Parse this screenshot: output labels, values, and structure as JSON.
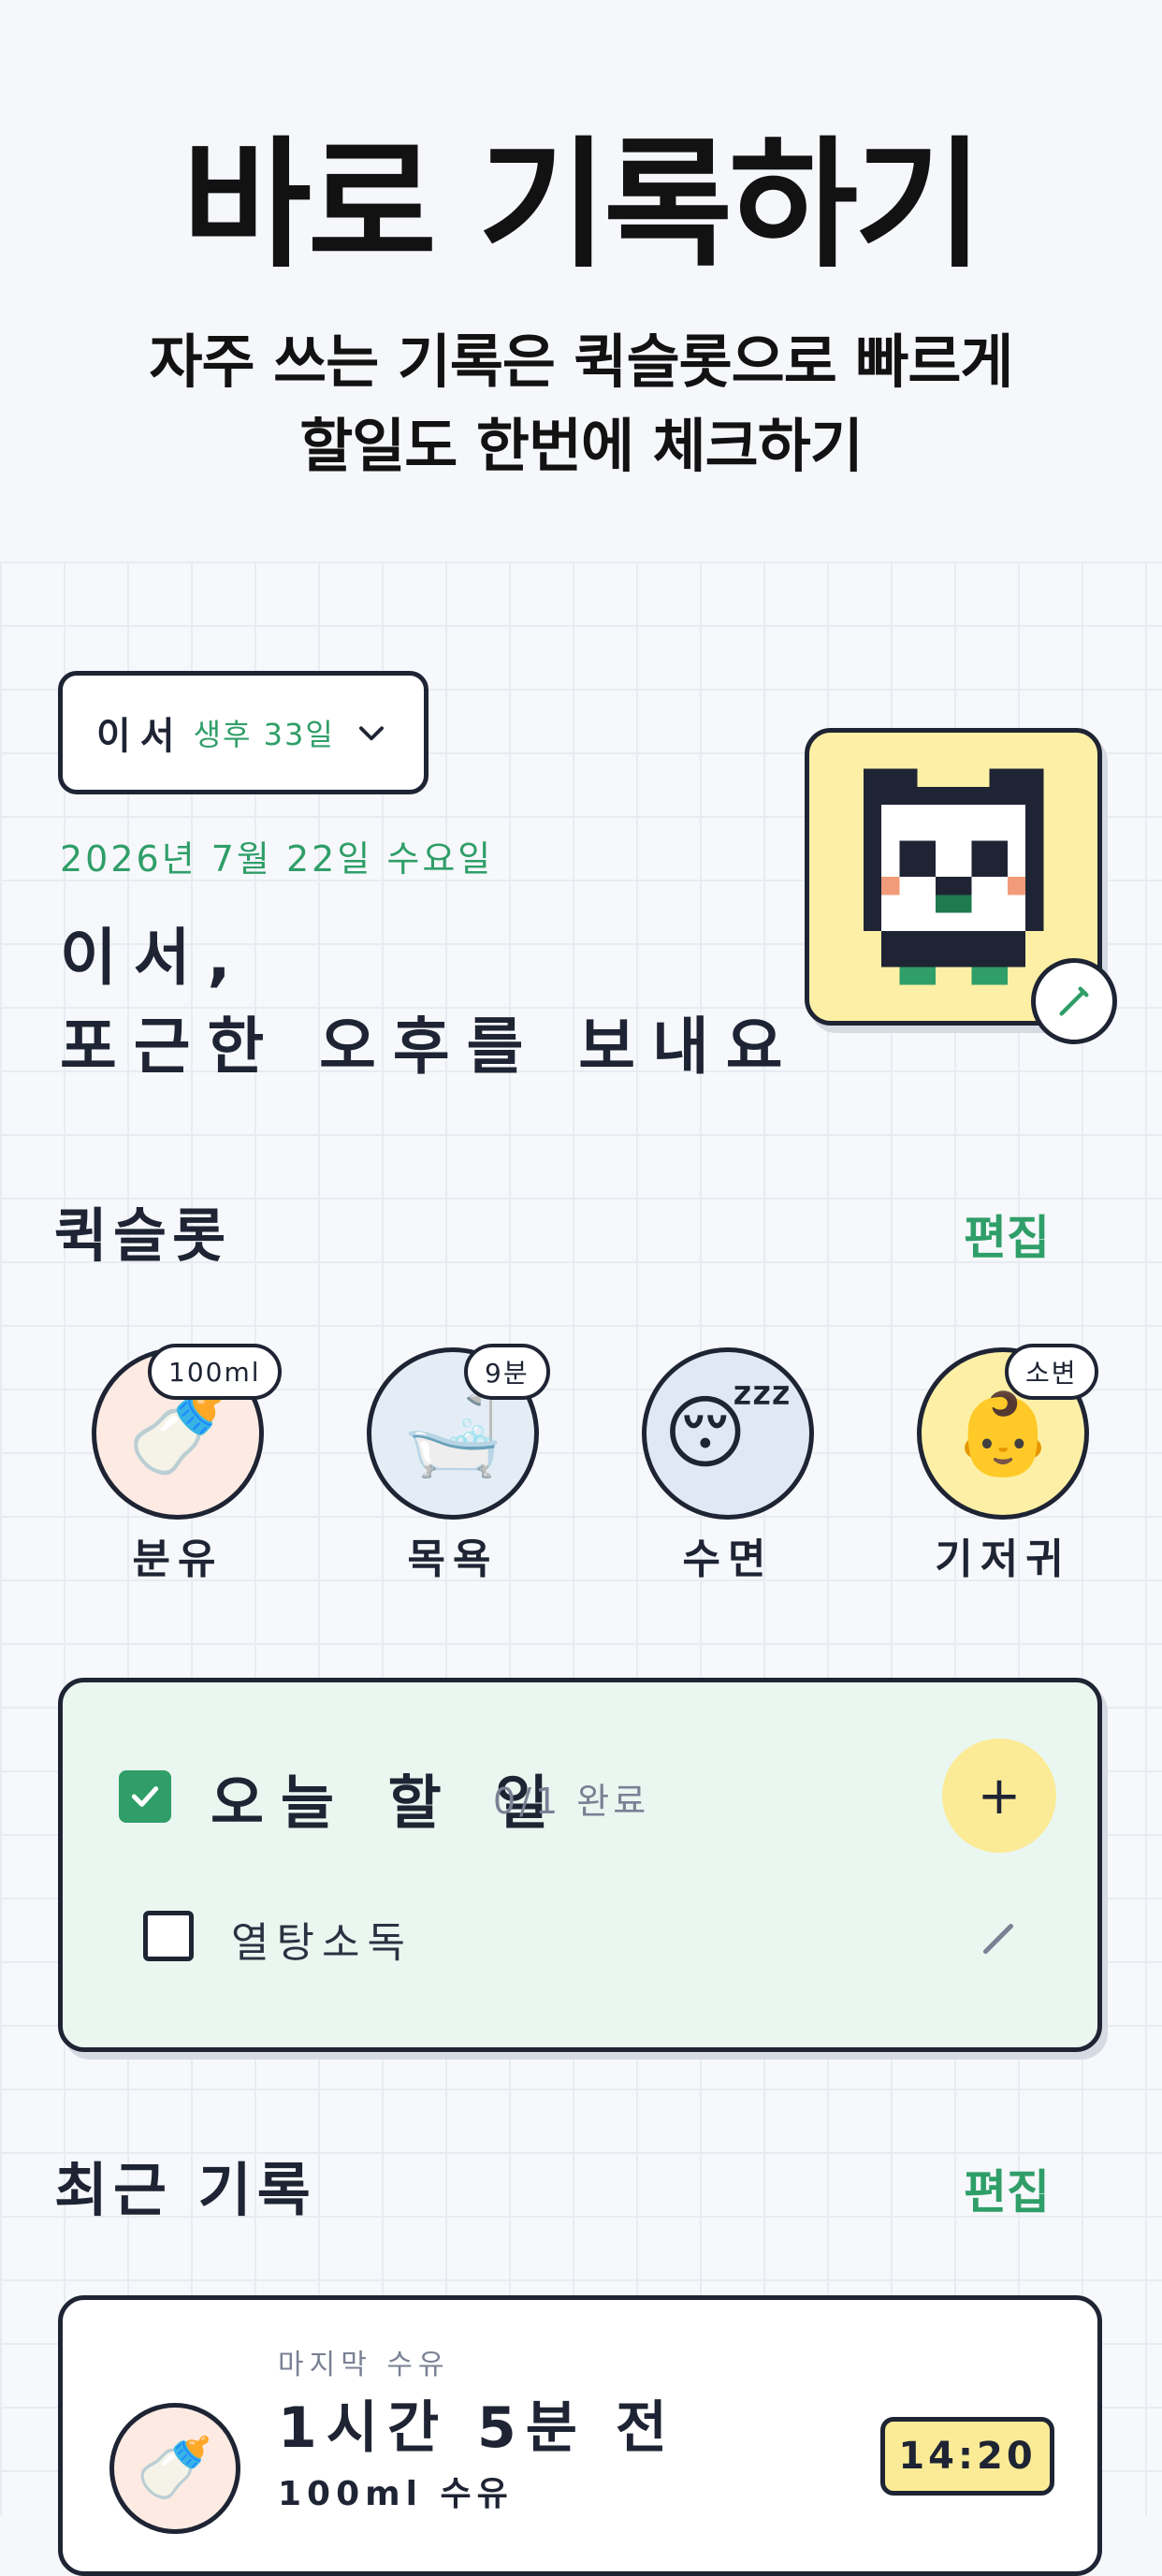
{
  "promo": {
    "title": "바로 기록하기",
    "subtitle_line1": "자주 쓰는 기록은 퀵슬롯으로 빠르게",
    "subtitle_line2": "할일도 한번에 체크하기"
  },
  "header": {
    "baby_name": "이서",
    "baby_age": "생후 33일",
    "date": "2026년 7월 22일 수요일",
    "greeting_line1": "이서,",
    "greeting_line2": "포근한 오후를 보내요"
  },
  "quickslot": {
    "title": "퀵슬롯",
    "edit_label": "편집",
    "items": [
      {
        "label": "분유",
        "badge": "100ml",
        "icon": "baby-bottle-icon",
        "emoji": "🍼",
        "color": "#fdebe3"
      },
      {
        "label": "목욕",
        "badge": "9분",
        "icon": "bathtub-icon",
        "emoji": "🛁",
        "color": "#e4edf6"
      },
      {
        "label": "수면",
        "badge": "",
        "icon": "sleeping-face-icon",
        "emoji": "😴",
        "color": "#e0e8f6"
      },
      {
        "label": "기저귀",
        "badge": "소변",
        "icon": "baby-face-icon",
        "emoji": "👶",
        "color": "#fdf0a6"
      }
    ]
  },
  "todo": {
    "title": "오늘 할 일",
    "count": "0/1 완료",
    "add_label": "+",
    "items": [
      {
        "label": "열탕소독",
        "checked": false
      }
    ]
  },
  "recent": {
    "title": "최근 기록",
    "edit_label": "편집",
    "card": {
      "label": "마지막 수유",
      "elapsed": "1시간 5분 전",
      "amount": "100ml 수유",
      "time": "14:20",
      "icon": "baby-bottle-icon",
      "emoji": "🍼"
    }
  },
  "colors": {
    "accent_green": "#2f9e68",
    "highlight_yellow": "#fbe9a0",
    "ink": "#1e2433"
  }
}
